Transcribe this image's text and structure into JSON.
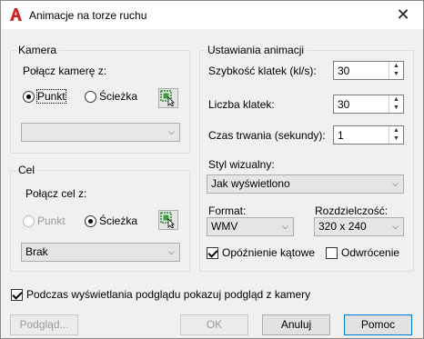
{
  "window": {
    "title": "Animacje na torze ruchu",
    "close_glyph": "✕"
  },
  "camera_group": {
    "title": "Kamera",
    "link_label": "Połącz kamerę z:",
    "radio_point": "Punkt",
    "radio_path": "Ścieżka",
    "selected": "point",
    "select_value": ""
  },
  "target_group": {
    "title": "Cel",
    "link_label": "Połącz cel z:",
    "radio_point": "Punkt",
    "radio_path": "Ścieżka",
    "selected": "path",
    "select_value": "Brak"
  },
  "animation_group": {
    "title": "Ustawiania animacji",
    "frame_rate_label": "Szybkość klatek (kl/s):",
    "frame_rate_value": "30",
    "frame_count_label": "Liczba klatek:",
    "frame_count_value": "30",
    "duration_label": "Czas trwania (sekundy):",
    "duration_value": "1",
    "visual_style_label": "Styl wizualny:",
    "visual_style_value": "Jak wyświetlono",
    "format_label": "Format:",
    "format_value": "WMV",
    "resolution_label": "Rozdzielczość:",
    "resolution_value": "320 x 240",
    "corner_deceleration_label": "Opóźnienie kątowe",
    "corner_deceleration_checked": true,
    "reverse_label": "Odwrócenie",
    "reverse_checked": false
  },
  "preview_checkbox": {
    "label": "Podczas wyświetlania podglądu pokazuj podgląd z kamery",
    "checked": true
  },
  "buttons": {
    "preview": "Podgląd...",
    "ok": "OK",
    "cancel": "Anuluj",
    "help": "Pomoc"
  },
  "colors": {
    "app_icon": "#d42020",
    "window_bg": "#f0f0f0",
    "default_border": "#0078d7"
  }
}
